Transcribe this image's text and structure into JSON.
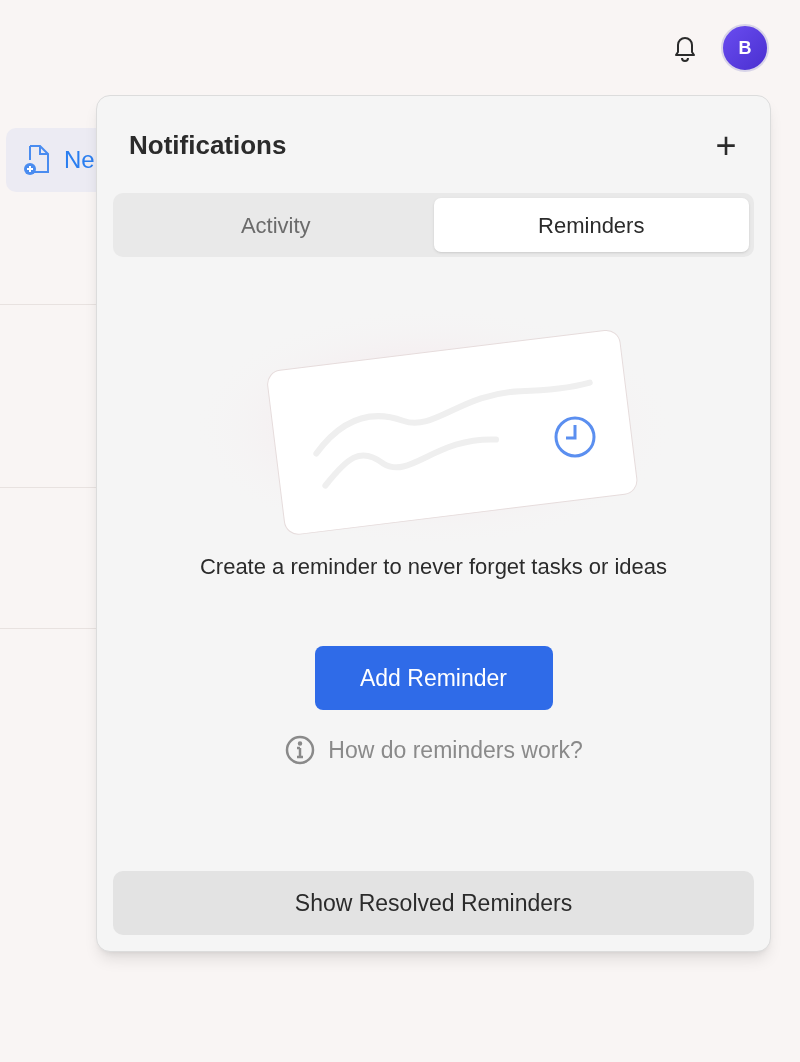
{
  "header": {
    "avatar_initial": "B"
  },
  "background": {
    "new_button_label": "Ne"
  },
  "popover": {
    "title": "Notifications",
    "add_symbol": "+",
    "tabs": [
      {
        "label": "Activity",
        "selected": false
      },
      {
        "label": "Reminders",
        "selected": true
      }
    ],
    "empty_state": {
      "message": "Create a reminder to never forget tasks or ideas",
      "primary_button": "Add Reminder",
      "help_link": "How do reminders work?"
    },
    "footer_button": "Show Resolved Reminders"
  }
}
